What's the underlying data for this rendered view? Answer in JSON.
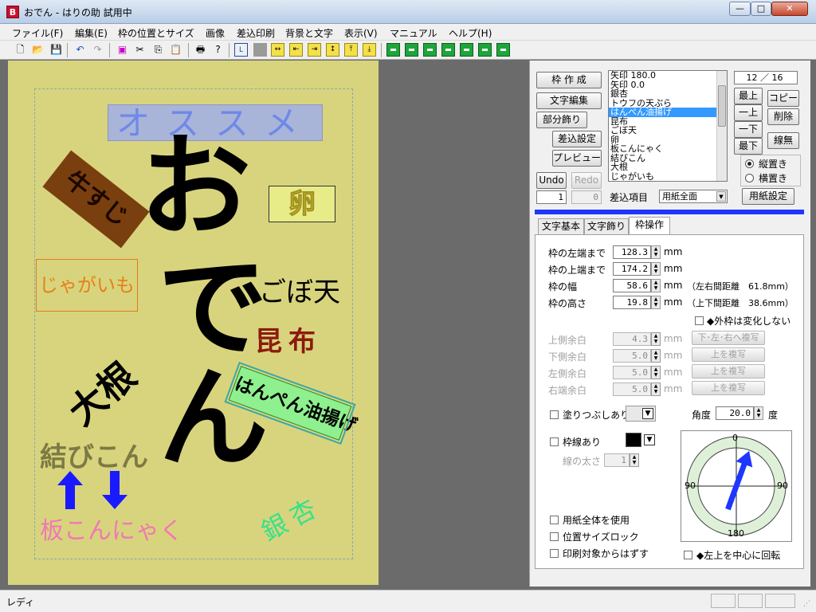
{
  "window": {
    "title": "おでん - はりの助 試用中",
    "app_icon": "B",
    "min": "—",
    "max": "□",
    "close": "✕"
  },
  "menu": [
    "ファイル(F)",
    "編集(E)",
    "枠の位置とサイズ",
    "画像",
    "差込印刷",
    "背景と文字",
    "表示(V)",
    "マニュアル",
    "ヘルプ(H)"
  ],
  "colors": {
    "paper": "#d8d47e",
    "accent_blue": "#1f36ff",
    "selection": "#3399ff"
  },
  "canvas": {
    "texts": {
      "osusume": "オススメ",
      "gyusuji": "牛すじ",
      "tamago": "卵",
      "oden_o": "お",
      "oden_den": "でん",
      "jagaimo": "じゃがいも",
      "gobouten": "ごぼ天",
      "konbu": "昆布",
      "daikon": "大根",
      "hanpen": "はんぺん油揚げ",
      "musubikon": "結びこん",
      "itakon": "板こんにゃく",
      "ginnan": "銀杏"
    }
  },
  "panel": {
    "buttons": {
      "waku_sakusei": "枠 作 成",
      "moji_henshu": "文字編集",
      "bubun_kazari": "部分飾り",
      "sashikomi_settei": "差込設定",
      "preview": "プレビュー",
      "undo": "Undo",
      "redo": "Redo",
      "saijo": "最上",
      "ichijo": "一上",
      "ichige": "一下",
      "saige": "最下",
      "copy": "コピー",
      "sakujo": "削除",
      "sen_nashi": "線無",
      "yoshi_settei": "用紙設定"
    },
    "counter": "12 ／ 16",
    "list_items": [
      "矢印 180.0",
      "矢印 0.0",
      "銀杏",
      "トウフの天ぷら",
      "はんぺん油揚げ",
      "昆布",
      "ごぼ天",
      "卵",
      "板こんにゃく",
      "結びこん",
      "大根",
      "じゃがいも"
    ],
    "selected_index": 4,
    "orient": {
      "vertical": "縦置き",
      "horizontal": "横置き"
    },
    "sashikomi_label": "差込項目",
    "field_a": "1",
    "field_b": "0",
    "paper_select": "用紙全面",
    "tabs": [
      "文字基本",
      "文字飾り",
      "枠操作"
    ],
    "frame": {
      "left_label": "枠の左端まで",
      "left_value": "128.3",
      "top_label": "枠の上端まで",
      "top_value": "174.2",
      "width_label": "枠の幅",
      "width_value": "58.6",
      "width_note": "（左右間距離　61.8mm）",
      "height_label": "枠の高さ",
      "height_value": "19.8",
      "height_note": "（上下間距離　38.6mm）",
      "unit": "mm",
      "outer_fixed": "◆外枠は変化しない"
    },
    "margins": {
      "top_label": "上側余白",
      "top_value": "4.3",
      "copy_top": "下･左･右へ複写",
      "bottom_label": "下側余白",
      "bottom_value": "5.0",
      "copy_bottom": "上を複写",
      "left_label": "左側余白",
      "left_value": "5.0",
      "copy_left": "上を複写",
      "right_label": "右端余白",
      "right_value": "5.0",
      "copy_right": "上を複写"
    },
    "fill_label": "塗りつぶしあり",
    "angle_label": "角度",
    "angle_value": "20.0",
    "angle_unit": "度",
    "border_label": "枠線あり",
    "line_width_label": "線の太さ",
    "line_width_value": "1",
    "compass": {
      "n": "0",
      "e": "90",
      "s": "180",
      "w": "90",
      "angle": 20
    },
    "use_whole_paper": "用紙全体を使用",
    "lock_position": "位置サイズロック",
    "exclude_print": "印刷対象からはずす",
    "rotate_center": "◆左上を中心に回転"
  },
  "status": {
    "text": "レディ"
  }
}
